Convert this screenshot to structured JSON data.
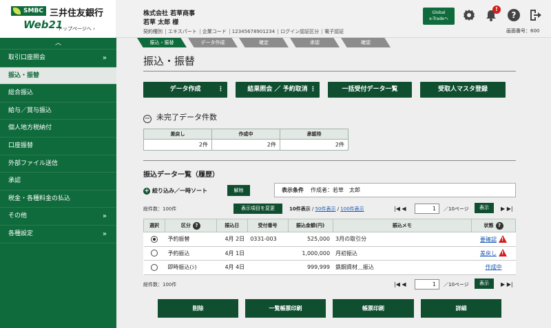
{
  "brand": {
    "smbc": "SMBC",
    "bank_name": "三井住友銀行",
    "web21": "Web21",
    "toppage_link": "トップページへ ›"
  },
  "header": {
    "company": "株式会社 若草商事",
    "user": "若草 太郎 様",
    "meta": [
      "契約種別",
      "エキスパート",
      "企業コード",
      "12345678901234",
      "ログイン認証区分",
      "電子認証"
    ],
    "global_btn_line1": "Global",
    "global_btn_line2": "e-Tradeへ",
    "notification_count": "!",
    "screen_no": "画面番号：600"
  },
  "sidebar": {
    "collapse_icon": "︿",
    "items": [
      {
        "label": "取引口座照会",
        "arrow": "»"
      },
      {
        "label": "振込・振替",
        "arrow": ""
      },
      {
        "label": "総合振込",
        "arrow": ""
      },
      {
        "label": "給与／賞与振込",
        "arrow": ""
      },
      {
        "label": "個人地方税納付",
        "arrow": ""
      },
      {
        "label": "口座振替",
        "arrow": ""
      },
      {
        "label": "外部ファイル送信",
        "arrow": ""
      },
      {
        "label": "承認",
        "arrow": ""
      },
      {
        "label": "税金・各種料金の払込",
        "arrow": ""
      },
      {
        "label": "その他",
        "arrow": "»"
      },
      {
        "label": "各種設定",
        "arrow": "»"
      }
    ]
  },
  "steps": [
    "振込・振替",
    "データ作成",
    "確定",
    "承認",
    "確認"
  ],
  "page_title": "振込・振替",
  "top_buttons": {
    "create": "データ作成",
    "create_dots": "⋮",
    "result": "結果照会 ／ 予約取消",
    "result_dots": "⋮",
    "bulk": "一括受付データ一覧",
    "payee": "受取人マスタ登録"
  },
  "pending": {
    "title": "未完了データ件数",
    "headers": [
      "差戻し",
      "作成中",
      "承認待"
    ],
    "values": [
      "2件",
      "2件",
      "2件"
    ]
  },
  "list": {
    "title": "振込データ一覧（履歴）",
    "filter_label": "絞り込み／一時ソート",
    "clear": "解除",
    "cond_label": "表示条件",
    "cond_value": "作成者：若草　太郎",
    "total": "総件数：100件",
    "display_items_btn": "表示項目を変更",
    "per_page": [
      "10件表示",
      "50件表示",
      "100件表示"
    ],
    "page_value": "1",
    "page_total": "／10ページ",
    "page_btn": "表示",
    "headers": [
      "選択",
      "区分",
      "振込日",
      "受付番号",
      "振込金額(円)",
      "振込メモ",
      "状態"
    ],
    "rows": [
      {
        "kubun": "予約振替",
        "date": "4月 2日",
        "receipt": "0331-003",
        "amount": "525,000",
        "memo": "3月の取引分",
        "status": "要確認",
        "warn": true,
        "selected": true
      },
      {
        "kubun": "予約振込",
        "date": "4月 1日",
        "receipt": "",
        "amount": "1,000,000",
        "memo": "月初振込",
        "status": "差戻し",
        "warn": true,
        "selected": false
      },
      {
        "kubun": "即時振込(ｼ)",
        "date": "4月 4日",
        "receipt": "",
        "amount": "999,999",
        "memo": "鉄鋼資材＿振込",
        "status": "作成中",
        "warn": false,
        "selected": false
      }
    ]
  },
  "bottom_buttons": [
    "削除",
    "一覧帳票印刷",
    "帳票印刷",
    "詳細"
  ],
  "colors": {
    "primary": "#0f6b3c",
    "dark": "#0f4f30",
    "link": "#1a58b4",
    "warn": "#d01e1e"
  }
}
